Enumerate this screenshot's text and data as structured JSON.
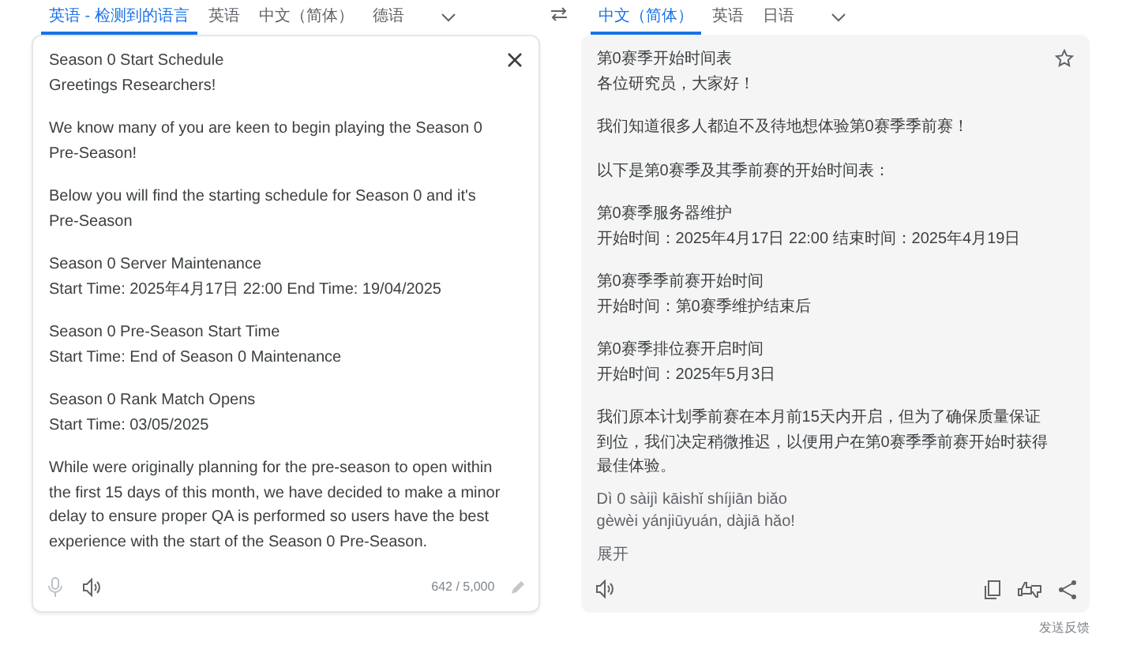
{
  "source_languages": [
    {
      "label": "英语 - 检测到的语言",
      "selected": true
    },
    {
      "label": "英语",
      "selected": false
    },
    {
      "label": "中文（简体）",
      "selected": false
    },
    {
      "label": "德语",
      "selected": false
    }
  ],
  "target_languages": [
    {
      "label": "中文（简体）",
      "selected": true
    },
    {
      "label": "英语",
      "selected": false
    },
    {
      "label": "日语",
      "selected": false
    }
  ],
  "source_text": [
    [
      "Season 0 Start Schedule",
      "Greetings Researchers!"
    ],
    [
      "We know many of you are keen to begin playing the Season 0 Pre-Season!"
    ],
    [
      "Below you will find the starting schedule for Season 0 and it's Pre-Season"
    ],
    [
      "Season 0 Server Maintenance",
      "Start Time: 2025年4月17日 22:00 End Time: 19/04/2025"
    ],
    [
      "Season 0 Pre-Season Start Time",
      "Start Time: End of Season 0 Maintenance"
    ],
    [
      "Season 0 Rank Match Opens",
      "Start Time: 03/05/2025"
    ],
    [
      "While were originally planning for the pre-season to open within the first 15 days of this month, we have decided to make a minor delay to ensure proper QA is performed so users have the best experience with the start of the Season 0 Pre-Season."
    ]
  ],
  "char_count": "642 / 5,000",
  "translation": [
    [
      "第0赛季开始时间表",
      "各位研究员，大家好！"
    ],
    [
      "我们知道很多人都迫不及待地想体验第0赛季季前赛！"
    ],
    [
      "以下是第0赛季及其季前赛的开始时间表："
    ],
    [
      "第0赛季服务器维护",
      "开始时间：2025年4月17日 22:00 结束时间：2025年4月19日"
    ],
    [
      "第0赛季季前赛开始时间",
      "开始时间：第0赛季维护结束后"
    ],
    [
      "第0赛季排位赛开启时间",
      "开始时间：2025年5月3日"
    ],
    [
      "我们原本计划季前赛在本月前15天内开启，但为了确保质量保证到位，我们决定稍微推迟，以便用户在第0赛季季前赛开始时获得最佳体验。"
    ]
  ],
  "romanization": [
    "Dì 0 sàijì kāishǐ shíjiān biǎo",
    "gèwèi yánjiūyuán, dàjiā hǎo!"
  ],
  "expand_link": "展开",
  "feedback_link": "发送反馈"
}
